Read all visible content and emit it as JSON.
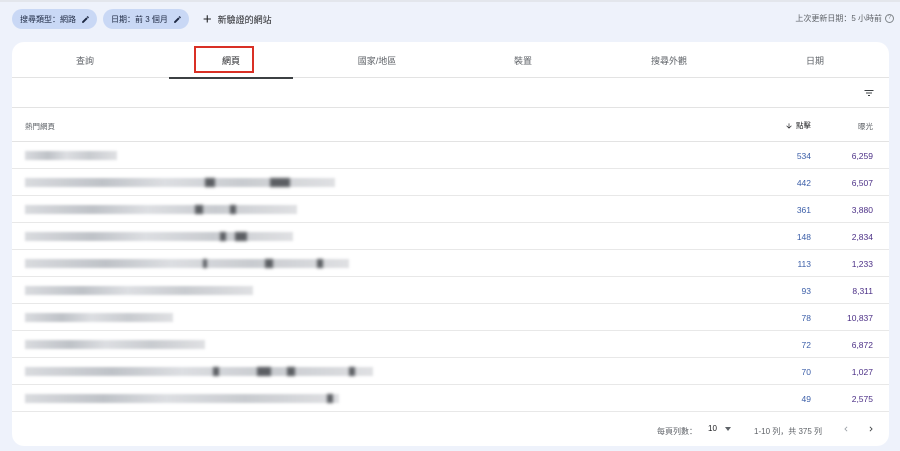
{
  "filters": {
    "chips": [
      {
        "label": "搜尋類型：網路"
      },
      {
        "label": "日期：前 3 個月"
      }
    ],
    "add_site_label": "新驗證的網站"
  },
  "last_updated": "上次更新日期：5 小時前",
  "tabs": [
    {
      "label": "查詢"
    },
    {
      "label": "網頁"
    },
    {
      "label": "國家/地區"
    },
    {
      "label": "裝置"
    },
    {
      "label": "搜尋外觀"
    },
    {
      "label": "日期"
    }
  ],
  "active_tab": "網頁",
  "table": {
    "headers": {
      "page": "熱門網頁",
      "clicks": "點擊",
      "impressions": "曝光"
    },
    "rows": [
      {
        "clicks": "534",
        "impressions": "6,259"
      },
      {
        "clicks": "442",
        "impressions": "6,507"
      },
      {
        "clicks": "361",
        "impressions": "3,880"
      },
      {
        "clicks": "148",
        "impressions": "2,834"
      },
      {
        "clicks": "113",
        "impressions": "1,233"
      },
      {
        "clicks": "93",
        "impressions": "8,311"
      },
      {
        "clicks": "78",
        "impressions": "10,837"
      },
      {
        "clicks": "72",
        "impressions": "6,872"
      },
      {
        "clicks": "70",
        "impressions": "1,027"
      },
      {
        "clicks": "49",
        "impressions": "2,575"
      }
    ]
  },
  "pagination": {
    "rows_per_page_label": "每頁列數：",
    "rows_per_page_value": "10",
    "range_label": "1-10 列，共 375 列"
  },
  "colors": {
    "clicks": "#3b5ea8",
    "impressions": "#4b2f86",
    "highlight": "#d93025",
    "chip": "#c9d8f5"
  }
}
